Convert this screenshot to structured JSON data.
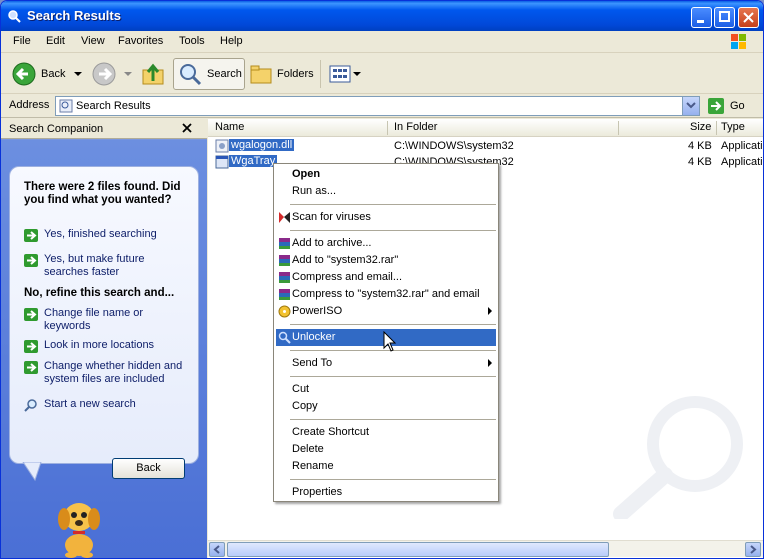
{
  "window": {
    "title": "Search Results"
  },
  "menu": [
    "File",
    "Edit",
    "View",
    "Favorites",
    "Tools",
    "Help"
  ],
  "toolbar": {
    "back": "Back",
    "search": "Search",
    "folders": "Folders"
  },
  "address": {
    "label": "Address",
    "value": "Search Results",
    "go": "Go"
  },
  "companion": {
    "title": "Search Companion",
    "found": "There were 2 files found. Did you find what you wanted?",
    "opt1": "Yes, finished searching",
    "opt2": "Yes, but make future searches faster",
    "refine": "No, refine this search and...",
    "opt3": "Change file name or keywords",
    "opt4": "Look in more locations",
    "opt5": "Change whether hidden and system files are included",
    "opt6": "Start a new search",
    "back": "Back"
  },
  "list": {
    "headers": {
      "name": "Name",
      "folder": "In Folder",
      "size": "Size",
      "type": "Type"
    },
    "rows": [
      {
        "name": "wgalogon.dll",
        "folder": "C:\\WINDOWS\\system32",
        "size": "4 KB",
        "type": "Applicati"
      },
      {
        "name": "WgaTray",
        "folder": "C:\\WINDOWS\\system32",
        "size": "4 KB",
        "type": "Applicati"
      }
    ]
  },
  "context_menu": {
    "open": "Open",
    "runas": "Run as...",
    "scan": "Scan for viruses",
    "addarchive": "Add to archive...",
    "addrar": "Add to \"system32.rar\"",
    "compress": "Compress and email...",
    "compressrar": "Compress to \"system32.rar\" and email",
    "poweriso": "PowerISO",
    "unlocker": "Unlocker",
    "sendto": "Send To",
    "cut": "Cut",
    "copy": "Copy",
    "shortcut": "Create Shortcut",
    "delete": "Delete",
    "rename": "Rename",
    "properties": "Properties"
  },
  "colors": {
    "title": "#0054e3",
    "selection": "#316ac5",
    "pane": "#6c8fe0"
  }
}
